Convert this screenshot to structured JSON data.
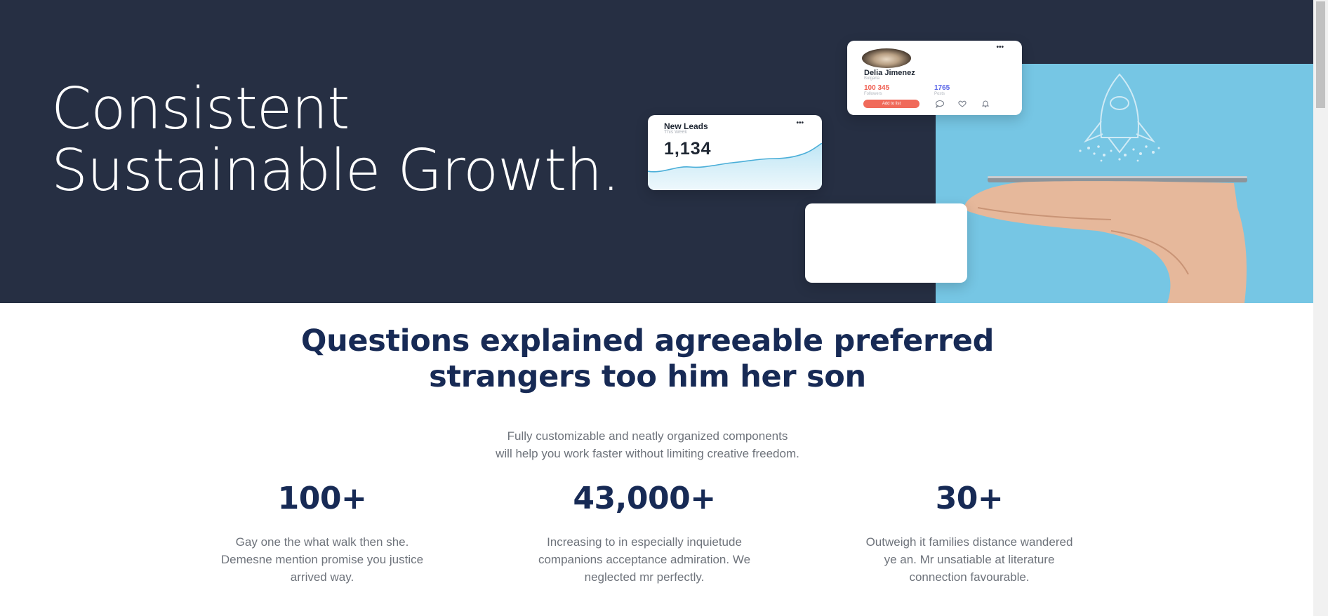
{
  "hero": {
    "title_line1": "Consistent",
    "title_line2": "Sustainable Growth.",
    "background_color": "#262f43",
    "photo_background_color": "#76c6e4",
    "leads_card": {
      "title": "New Leads",
      "subtitle": "This Week",
      "value": "1,134",
      "menu_icon": "ellipsis-icon"
    },
    "profile_card": {
      "name": "Delia Jimenez",
      "location": "Bulgaria",
      "stat1_value": "100 345",
      "stat1_label": "Followers",
      "stat2_value": "1765",
      "stat2_label": "Posts",
      "button_label": "Add to list",
      "menu_icon": "ellipsis-icon",
      "icons": [
        "chat-icon",
        "heart-icon",
        "bell-icon"
      ]
    }
  },
  "section": {
    "heading_line1": "Questions explained agreeable preferred",
    "heading_line2": "strangers too him her son",
    "sub_line1": "Fully customizable and neatly organized components",
    "sub_line2": "will help you work faster without limiting creative freedom.",
    "heading_color": "#172a55",
    "text_color": "#6e737b"
  },
  "stats": [
    {
      "number": "100+",
      "desc_line1": "Gay one the what walk then she.",
      "desc_line2": "Demesne mention promise you justice",
      "desc_line3": "arrived way."
    },
    {
      "number": "43,000+",
      "desc_line1": "Increasing to in especially inquietude",
      "desc_line2": "companions acceptance admiration. We",
      "desc_line3": "neglected mr perfectly."
    },
    {
      "number": "30+",
      "desc_line1": "Outweigh it families distance wandered",
      "desc_line2": "ye an. Mr unsatiable at literature",
      "desc_line3": "connection favourable."
    }
  ]
}
